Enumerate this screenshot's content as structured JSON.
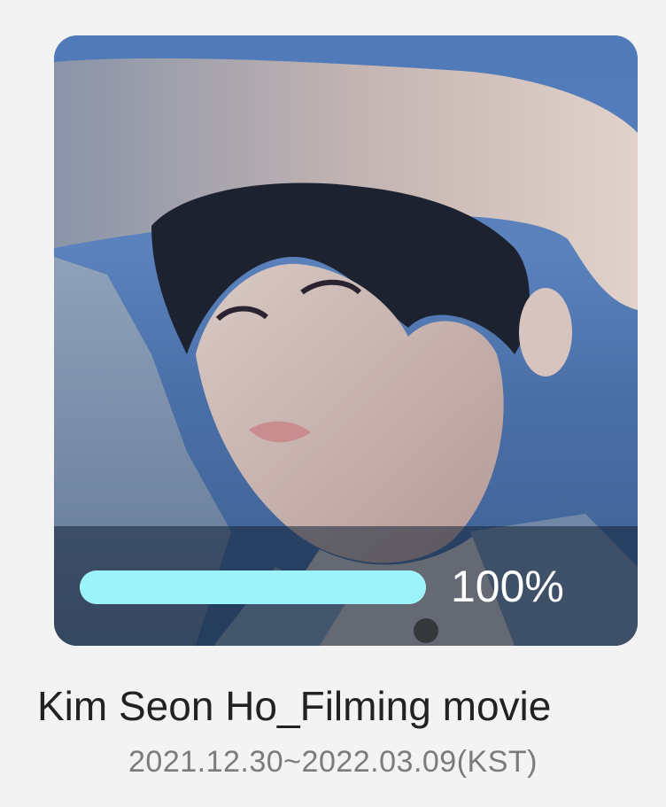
{
  "card": {
    "image_alt": "Kim Seon Ho portrait",
    "progress_percent": 100,
    "progress_label": "100%",
    "title": "Kim Seon Ho_Filming movie",
    "date_range": "2021.12.30~2022.03.09(KST)"
  },
  "colors": {
    "progress_fill": "#9df3fa",
    "progress_track": "#e8e8e8",
    "title_text": "#222222",
    "date_text": "#7b7b7b",
    "background": "#f3f3f3"
  }
}
